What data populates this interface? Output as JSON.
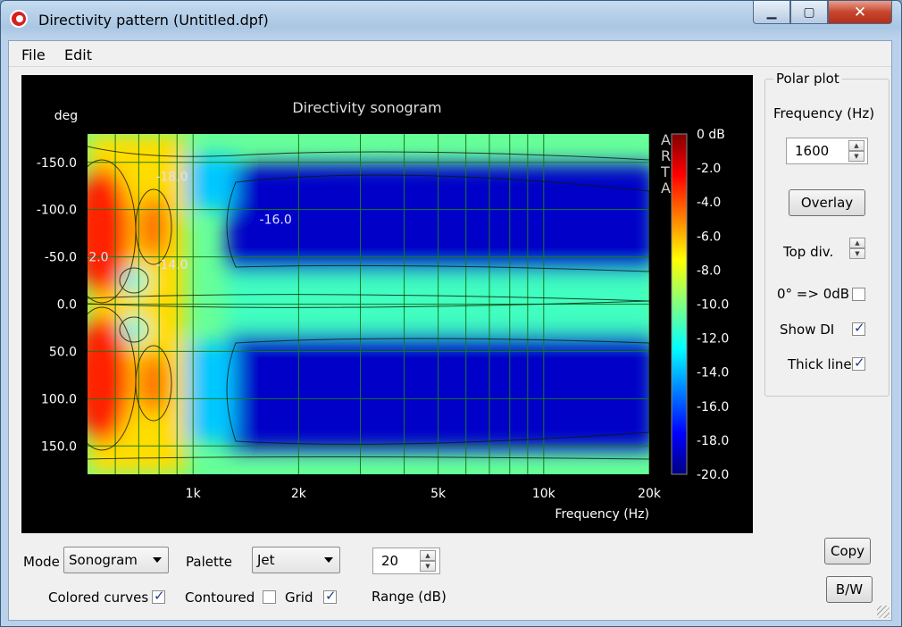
{
  "window": {
    "title": "Directivity pattern (Untitled.dpf)",
    "min_glyph": "▁",
    "max_glyph": "▢",
    "close_glyph": "✕"
  },
  "menu": {
    "file": "File",
    "edit": "Edit"
  },
  "chart_data": {
    "type": "heatmap",
    "title": "Directivity sonogram",
    "xlabel": "Frequency (Hz)",
    "ylabel": "deg",
    "x_scale": "log",
    "xlim": [
      500,
      20000
    ],
    "ylim": [
      -180,
      180
    ],
    "x_ticks": [
      "1k",
      "2k",
      "5k",
      "10k",
      "20k"
    ],
    "y_ticks": [
      "-150.0",
      "-100.0",
      "-50.0",
      "0.0",
      "50.0",
      "100.0",
      "150.0"
    ],
    "colorbar_ticks": [
      "0 dB",
      "-2.0",
      "-4.0",
      "-6.0",
      "-8.0",
      "-10.0",
      "-12.0",
      "-14.0",
      "-16.0",
      "-18.0",
      "-20.0"
    ],
    "contour_labels": [
      {
        "text": "-18.0",
        "freq": 870,
        "deg": -135
      },
      {
        "text": "-16.0",
        "freq": 1720,
        "deg": -90
      },
      {
        "text": "-14.0",
        "freq": 870,
        "deg": -42
      },
      {
        "text": "-2.0",
        "freq": 530,
        "deg": -50
      }
    ],
    "watermark": "ARTA",
    "palette": "jet",
    "grid": true
  },
  "polar": {
    "group_label": "Polar plot",
    "frequency_label": "Frequency (Hz)",
    "frequency_value": "1600",
    "overlay_label": "Overlay",
    "topdiv_label": "Top div.",
    "zero_label": "0° => 0dB",
    "zero_checked": false,
    "showdi_label": "Show DI",
    "showdi_checked": true,
    "thick_label": "Thick line",
    "thick_checked": true
  },
  "bottom": {
    "mode_label": "Mode",
    "mode_value": "Sonogram",
    "palette_label": "Palette",
    "palette_value": "Jet",
    "range_value": "20",
    "range_label": "Range (dB)",
    "colored_label": "Colored curves",
    "colored_checked": true,
    "contoured_label": "Contoured",
    "contoured_checked": false,
    "grid_label": "Grid",
    "grid_checked": true,
    "copy_label": "Copy",
    "bw_label": "B/W"
  }
}
